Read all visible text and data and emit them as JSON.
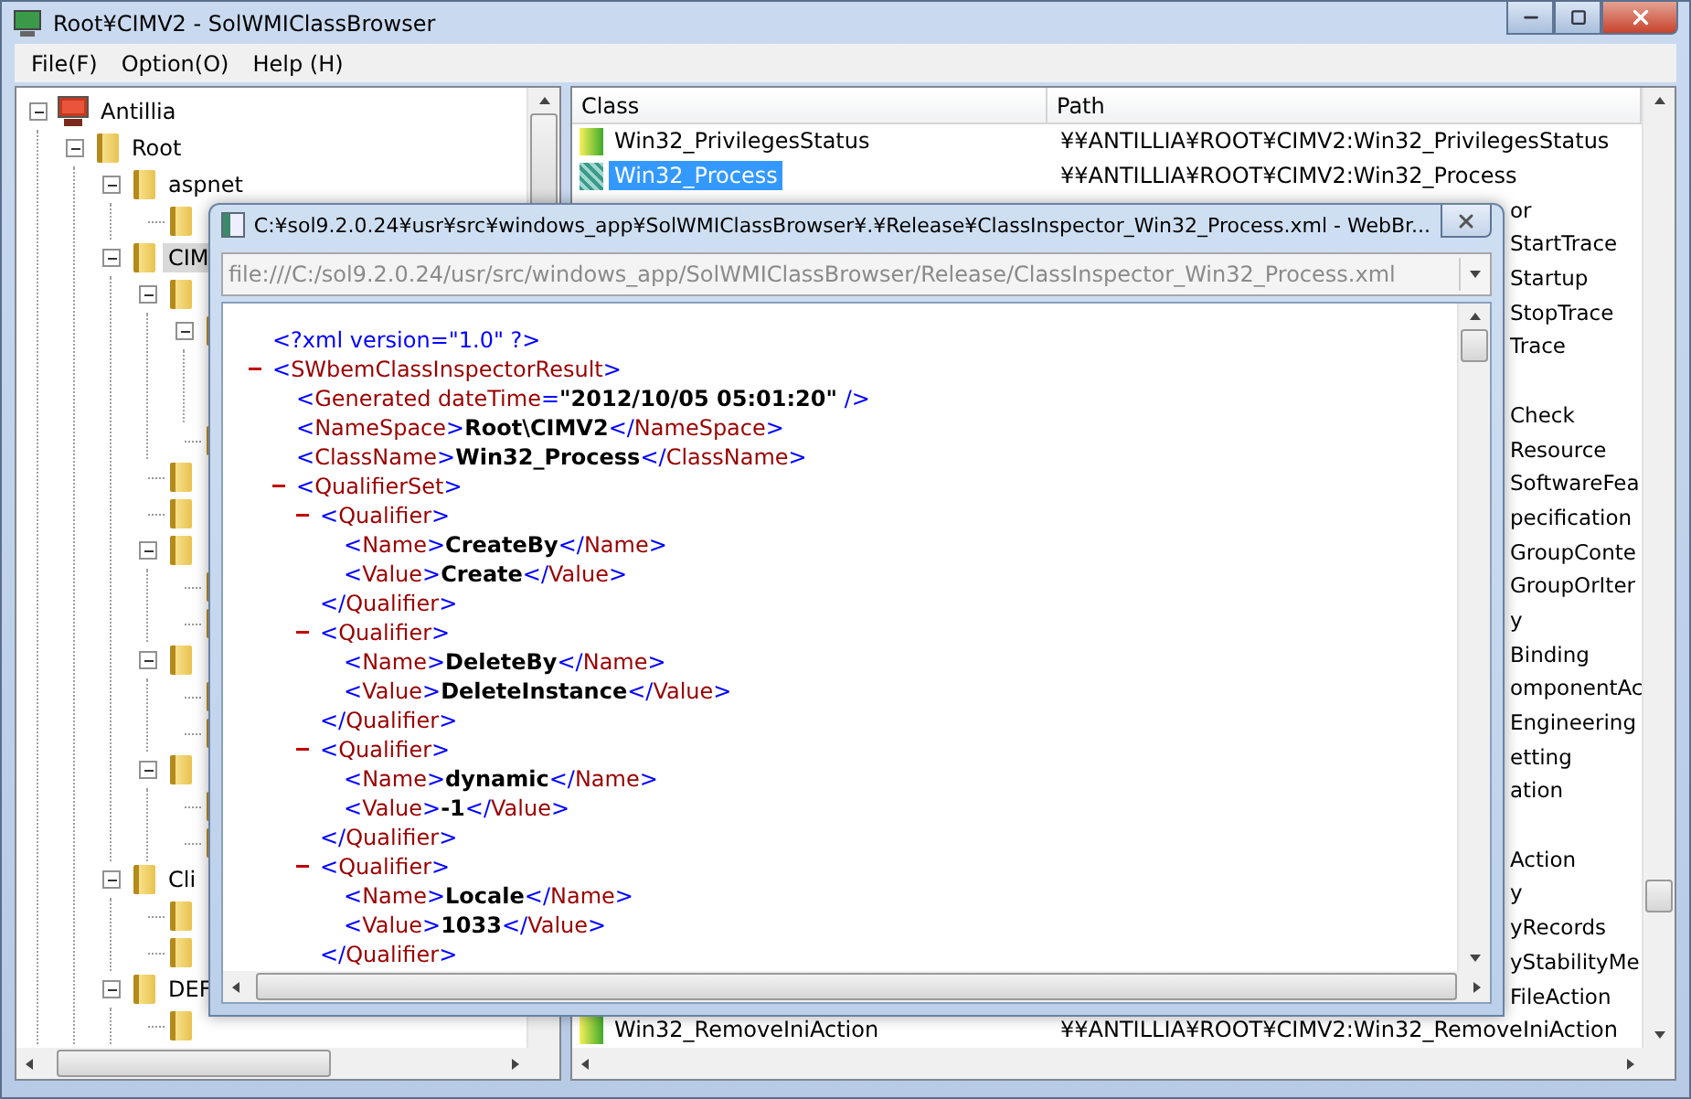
{
  "window": {
    "title": "Root¥CIMV2 - SolWMIClassBrowser"
  },
  "menu": [
    "File(F)",
    "Option(O)",
    "Help (H)"
  ],
  "tree": [
    {
      "kind": "computer",
      "label": "Antillia",
      "expanded": true,
      "selected": false,
      "children": [
        {
          "kind": "folder",
          "label": "Root",
          "expanded": true,
          "selected": false,
          "children": [
            {
              "kind": "folder",
              "label": "aspnet",
              "expanded": true,
              "selected": false,
              "children": [
                {
                  "kind": "folder",
                  "selected": false
                }
              ]
            },
            {
              "kind": "folder",
              "label": "CIM",
              "expanded": true,
              "selected": true,
              "children": [
                {
                  "kind": "folder",
                  "expanded": true,
                  "selected": false,
                  "children": [
                    {
                      "kind": "folder",
                      "expanded": true,
                      "selected": false
                    },
                    {
                      "kind": "folder",
                      "selected": false
                    }
                  ]
                },
                {
                  "kind": "folder",
                  "selected": false
                },
                {
                  "kind": "folder",
                  "selected": false
                },
                {
                  "kind": "folder",
                  "expanded": true,
                  "selected": false,
                  "children": [
                    {
                      "kind": "folder",
                      "selected": false
                    },
                    {
                      "kind": "folder",
                      "selected": false
                    }
                  ]
                },
                {
                  "kind": "folder",
                  "expanded": true,
                  "selected": false,
                  "children": [
                    {
                      "kind": "folder",
                      "selected": false
                    },
                    {
                      "kind": "folder",
                      "selected": false
                    }
                  ]
                },
                {
                  "kind": "folder",
                  "expanded": true,
                  "selected": false,
                  "children": [
                    {
                      "kind": "folder",
                      "selected": false
                    },
                    {
                      "kind": "folder",
                      "selected": false
                    }
                  ]
                }
              ]
            },
            {
              "kind": "folder",
              "label": "Cli",
              "expanded": true,
              "selected": false,
              "children": [
                {
                  "kind": "folder",
                  "selected": false
                },
                {
                  "kind": "folder",
                  "selected": false
                }
              ]
            },
            {
              "kind": "folder",
              "label": "DEF",
              "expanded": true,
              "selected": false,
              "children": [
                {
                  "kind": "folder",
                  "selected": false
                }
              ]
            }
          ]
        }
      ]
    }
  ],
  "list": {
    "columns": [
      "Class",
      "Path"
    ],
    "rows": [
      {
        "kind": "full",
        "class": "Win32_PrivilegesStatus",
        "path": "¥¥ANTILLIA¥ROOT¥CIMV2:Win32_PrivilegesStatus",
        "selected": false
      },
      {
        "kind": "full",
        "class": "Win32_Process",
        "path": "¥¥ANTILLIA¥ROOT¥CIMV2:Win32_Process",
        "selected": true
      },
      {
        "kind": "clipped",
        "path": "or"
      },
      {
        "kind": "clipped",
        "path": "StartTrace"
      },
      {
        "kind": "clipped",
        "path": "Startup"
      },
      {
        "kind": "clipped",
        "path": "StopTrace"
      },
      {
        "kind": "clipped",
        "path": "Trace"
      },
      {
        "kind": "clipped"
      },
      {
        "kind": "clipped",
        "path": "Check"
      },
      {
        "kind": "clipped",
        "path": "Resource"
      },
      {
        "kind": "clipped",
        "path": "SoftwareFea"
      },
      {
        "kind": "clipped",
        "path": "pecification"
      },
      {
        "kind": "clipped",
        "path": "GroupConte"
      },
      {
        "kind": "clipped",
        "path": "GroupOrIter"
      },
      {
        "kind": "clipped",
        "path": "y"
      },
      {
        "kind": "clipped",
        "path": "Binding"
      },
      {
        "kind": "clipped",
        "path": "omponentAc"
      },
      {
        "kind": "clipped",
        "path": "Engineering"
      },
      {
        "kind": "clipped",
        "path": "etting"
      },
      {
        "kind": "clipped",
        "path": "ation"
      },
      {
        "kind": "clipped"
      },
      {
        "kind": "clipped",
        "path": "Action"
      },
      {
        "kind": "clipped",
        "path": "y"
      },
      {
        "kind": "clipped",
        "path": "yRecords"
      },
      {
        "kind": "clipped",
        "path": "yStabilityMe"
      },
      {
        "kind": "clipped",
        "path": "FileAction"
      },
      {
        "kind": "full",
        "class": "Win32_RemoveIniAction",
        "path": "¥¥ANTILLIA¥ROOT¥CIMV2:Win32_RemoveIniAction",
        "selected": false
      }
    ]
  },
  "dialog": {
    "title": "C:¥sol9.2.0.24¥usr¥src¥windows_app¥SolWMIClassBrowser¥.¥Release¥ClassInspector_Win32_Process.xml - WebBr...",
    "address": "file:///C:/sol9.2.0.24/usr/src/windows_app/SolWMIClassBrowser/Release/ClassInspector_Win32_Process.xml",
    "xml": [
      {
        "kind": "pi",
        "open": "<?xml version=\"1.0\" ?>"
      },
      {
        "kind": "element",
        "open": "<SWbemClassInspectorResult>",
        "expanded": true,
        "children": [
          {
            "kind": "leaf",
            "open": "<Generated dateTime=",
            "text": "\"2012/10/05 05:01:20\"",
            "close": " />"
          },
          {
            "kind": "leaf",
            "open": "<NameSpace>",
            "text": "Root\\CIMV2",
            "close": "</NameSpace>"
          },
          {
            "kind": "leaf",
            "open": "<ClassName>",
            "text": "Win32_Process",
            "close": "</ClassName>"
          },
          {
            "kind": "element",
            "open": "<QualifierSet>",
            "expanded": true,
            "children": [
              {
                "kind": "element",
                "open": "<Qualifier>",
                "expanded": true,
                "end": "</Qualifier>",
                "children": [
                  {
                    "kind": "leaf",
                    "open": "<Name>",
                    "text": "CreateBy",
                    "close": "</Name>"
                  },
                  {
                    "kind": "leaf",
                    "open": "<Value>",
                    "text": "Create",
                    "close": "</Value>"
                  }
                ]
              },
              {
                "kind": "element",
                "open": "<Qualifier>",
                "expanded": true,
                "end": "</Qualifier>",
                "children": [
                  {
                    "kind": "leaf",
                    "open": "<Name>",
                    "text": "DeleteBy",
                    "close": "</Name>"
                  },
                  {
                    "kind": "leaf",
                    "open": "<Value>",
                    "text": "DeleteInstance",
                    "close": "</Value>"
                  }
                ]
              },
              {
                "kind": "element",
                "open": "<Qualifier>",
                "expanded": true,
                "end": "</Qualifier>",
                "children": [
                  {
                    "kind": "leaf",
                    "open": "<Name>",
                    "text": "dynamic",
                    "close": "</Name>"
                  },
                  {
                    "kind": "leaf",
                    "open": "<Value>",
                    "text": "-1",
                    "close": "</Value>"
                  }
                ]
              },
              {
                "kind": "element",
                "open": "<Qualifier>",
                "expanded": true,
                "end": "</Qualifier>",
                "children": [
                  {
                    "kind": "leaf",
                    "open": "<Name>",
                    "text": "Locale",
                    "close": "</Name>"
                  },
                  {
                    "kind": "leaf",
                    "open": "<Value>",
                    "text": "1033",
                    "close": "</Value>"
                  }
                ]
              }
            ]
          }
        ]
      }
    ]
  }
}
